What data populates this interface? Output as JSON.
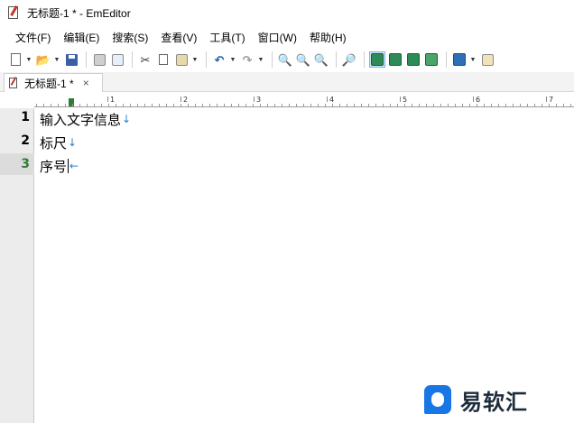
{
  "window": {
    "title": "无标题-1 * - EmEditor"
  },
  "menu": [
    "文件(F)",
    "编辑(E)",
    "搜索(S)",
    "查看(V)",
    "工具(T)",
    "窗口(W)",
    "帮助(H)"
  ],
  "toolbar": {
    "icons": {
      "new": "new-doc-icon",
      "open": "open-folder-icon",
      "save": "save-icon",
      "print": "print-icon",
      "print_preview": "print-preview-icon",
      "cut": "cut-icon",
      "copy": "copy-icon",
      "paste": "paste-icon",
      "undo": "undo-icon",
      "redo": "redo-icon",
      "find": "find-icon",
      "find_next": "find-next-icon",
      "find_prev": "find-prev-icon",
      "highlight": "highlight-icon",
      "wrap": "wrap-icon",
      "view_mode": "view-mode-icon",
      "sync": "sync-icon",
      "export": "export-icon",
      "macro": "macro-icon",
      "config": "config-icon"
    }
  },
  "tab": {
    "label": "无标题-1 *",
    "close": "×"
  },
  "ruler": {
    "labels": [
      "1",
      "2",
      "3",
      "4",
      "5",
      "6",
      "7"
    ]
  },
  "editor": {
    "lines": [
      {
        "number": "1",
        "text": "输入文字信息",
        "eol": "↓"
      },
      {
        "number": "2",
        "text": "标尺",
        "eol": "↓"
      },
      {
        "number": "3",
        "text": "序号",
        "eol": "←"
      }
    ],
    "current_line": 3,
    "eol_color": "#2a7fcf"
  },
  "watermark": {
    "text": "易软汇",
    "brand_color": "#1877e5"
  }
}
